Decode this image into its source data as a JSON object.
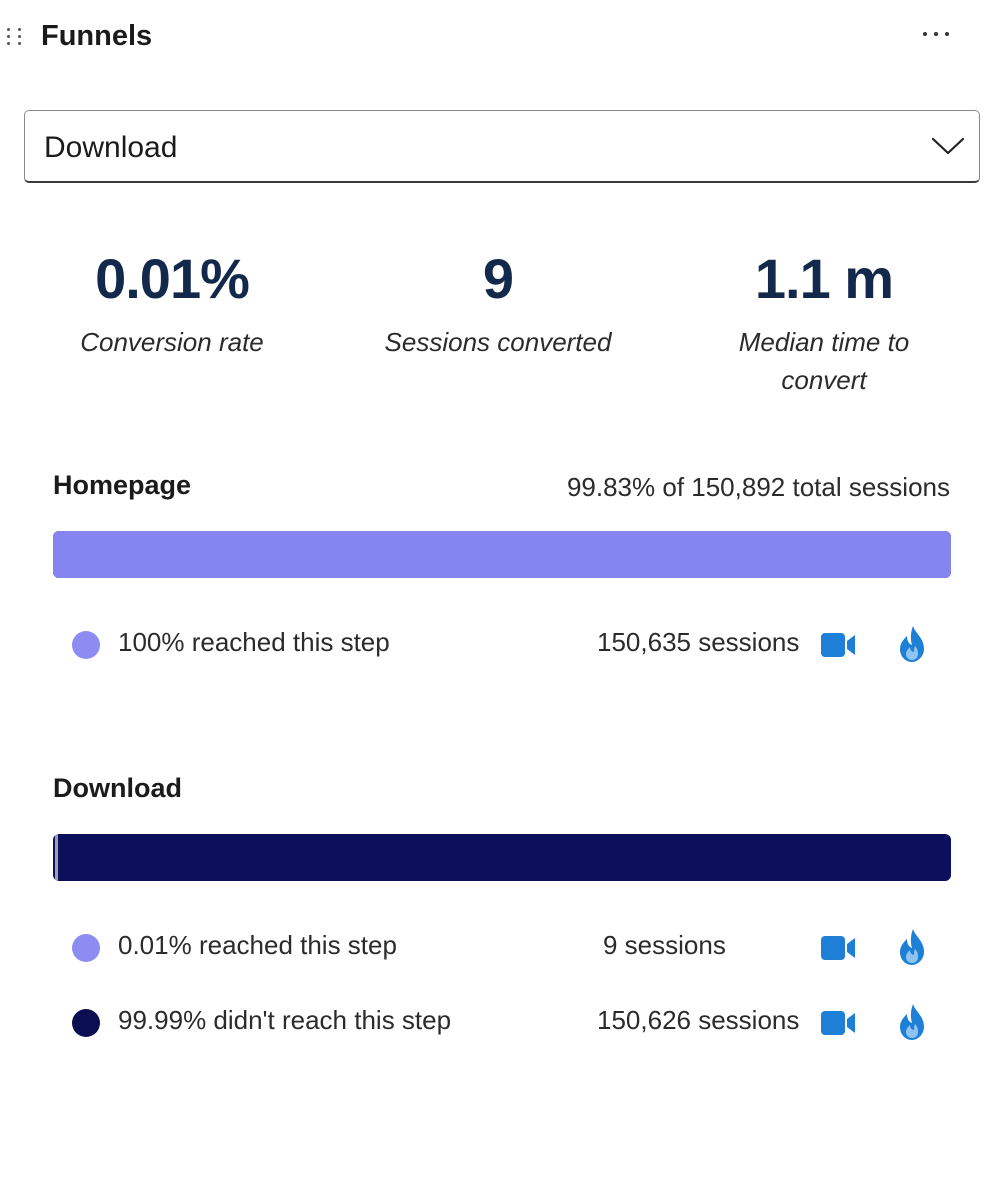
{
  "header": {
    "title": "Funnels",
    "drag_icon": "drag-handle-icon",
    "more_icon": "more-horizontal-icon"
  },
  "funnel_select": {
    "value": "Download",
    "icon": "chevron-down-icon"
  },
  "metrics": {
    "conversion_rate": {
      "value": "0.01%",
      "label": "Conversion rate"
    },
    "sessions_converted": {
      "value": "9",
      "label": "Sessions converted"
    },
    "median_time": {
      "value": "1.1 m",
      "label_line1": "Median time to",
      "label_line2": "convert"
    }
  },
  "steps": [
    {
      "title": "Homepage",
      "total_text": "99.83% of 150,892 total sessions",
      "bar": {
        "reached_fraction": 1.0
      },
      "rows": [
        {
          "legend": "100% reached this step",
          "sessions": "150,635 sessions",
          "kind": "reached"
        }
      ]
    },
    {
      "title": "Download",
      "total_text": "",
      "bar": {
        "reached_fraction": 0.0001
      },
      "rows": [
        {
          "legend": "0.01% reached this step",
          "sessions": "9 sessions",
          "kind": "reached"
        },
        {
          "legend": "99.99% didn't reach this step",
          "sessions": "150,626 sessions",
          "kind": "not-reached"
        }
      ]
    }
  ],
  "icons": {
    "recording": "video-camera-icon",
    "heatmap": "flame-icon"
  },
  "colors": {
    "reached": "#8585f2",
    "not_reached": "#0b0f5c",
    "metric_value": "#13294b",
    "icon_blue": "#1e7fd6"
  }
}
